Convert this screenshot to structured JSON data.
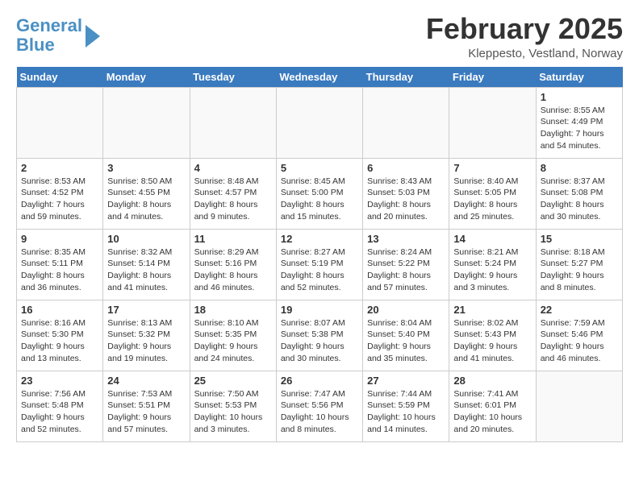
{
  "logo": {
    "line1": "General",
    "line2": "Blue"
  },
  "title": "February 2025",
  "subtitle": "Kleppesto, Vestland, Norway",
  "days_of_week": [
    "Sunday",
    "Monday",
    "Tuesday",
    "Wednesday",
    "Thursday",
    "Friday",
    "Saturday"
  ],
  "weeks": [
    [
      {
        "day": "",
        "info": ""
      },
      {
        "day": "",
        "info": ""
      },
      {
        "day": "",
        "info": ""
      },
      {
        "day": "",
        "info": ""
      },
      {
        "day": "",
        "info": ""
      },
      {
        "day": "",
        "info": ""
      },
      {
        "day": "1",
        "info": "Sunrise: 8:55 AM\nSunset: 4:49 PM\nDaylight: 7 hours\nand 54 minutes."
      }
    ],
    [
      {
        "day": "2",
        "info": "Sunrise: 8:53 AM\nSunset: 4:52 PM\nDaylight: 7 hours\nand 59 minutes."
      },
      {
        "day": "3",
        "info": "Sunrise: 8:50 AM\nSunset: 4:55 PM\nDaylight: 8 hours\nand 4 minutes."
      },
      {
        "day": "4",
        "info": "Sunrise: 8:48 AM\nSunset: 4:57 PM\nDaylight: 8 hours\nand 9 minutes."
      },
      {
        "day": "5",
        "info": "Sunrise: 8:45 AM\nSunset: 5:00 PM\nDaylight: 8 hours\nand 15 minutes."
      },
      {
        "day": "6",
        "info": "Sunrise: 8:43 AM\nSunset: 5:03 PM\nDaylight: 8 hours\nand 20 minutes."
      },
      {
        "day": "7",
        "info": "Sunrise: 8:40 AM\nSunset: 5:05 PM\nDaylight: 8 hours\nand 25 minutes."
      },
      {
        "day": "8",
        "info": "Sunrise: 8:37 AM\nSunset: 5:08 PM\nDaylight: 8 hours\nand 30 minutes."
      }
    ],
    [
      {
        "day": "9",
        "info": "Sunrise: 8:35 AM\nSunset: 5:11 PM\nDaylight: 8 hours\nand 36 minutes."
      },
      {
        "day": "10",
        "info": "Sunrise: 8:32 AM\nSunset: 5:14 PM\nDaylight: 8 hours\nand 41 minutes."
      },
      {
        "day": "11",
        "info": "Sunrise: 8:29 AM\nSunset: 5:16 PM\nDaylight: 8 hours\nand 46 minutes."
      },
      {
        "day": "12",
        "info": "Sunrise: 8:27 AM\nSunset: 5:19 PM\nDaylight: 8 hours\nand 52 minutes."
      },
      {
        "day": "13",
        "info": "Sunrise: 8:24 AM\nSunset: 5:22 PM\nDaylight: 8 hours\nand 57 minutes."
      },
      {
        "day": "14",
        "info": "Sunrise: 8:21 AM\nSunset: 5:24 PM\nDaylight: 9 hours\nand 3 minutes."
      },
      {
        "day": "15",
        "info": "Sunrise: 8:18 AM\nSunset: 5:27 PM\nDaylight: 9 hours\nand 8 minutes."
      }
    ],
    [
      {
        "day": "16",
        "info": "Sunrise: 8:16 AM\nSunset: 5:30 PM\nDaylight: 9 hours\nand 13 minutes."
      },
      {
        "day": "17",
        "info": "Sunrise: 8:13 AM\nSunset: 5:32 PM\nDaylight: 9 hours\nand 19 minutes."
      },
      {
        "day": "18",
        "info": "Sunrise: 8:10 AM\nSunset: 5:35 PM\nDaylight: 9 hours\nand 24 minutes."
      },
      {
        "day": "19",
        "info": "Sunrise: 8:07 AM\nSunset: 5:38 PM\nDaylight: 9 hours\nand 30 minutes."
      },
      {
        "day": "20",
        "info": "Sunrise: 8:04 AM\nSunset: 5:40 PM\nDaylight: 9 hours\nand 35 minutes."
      },
      {
        "day": "21",
        "info": "Sunrise: 8:02 AM\nSunset: 5:43 PM\nDaylight: 9 hours\nand 41 minutes."
      },
      {
        "day": "22",
        "info": "Sunrise: 7:59 AM\nSunset: 5:46 PM\nDaylight: 9 hours\nand 46 minutes."
      }
    ],
    [
      {
        "day": "23",
        "info": "Sunrise: 7:56 AM\nSunset: 5:48 PM\nDaylight: 9 hours\nand 52 minutes."
      },
      {
        "day": "24",
        "info": "Sunrise: 7:53 AM\nSunset: 5:51 PM\nDaylight: 9 hours\nand 57 minutes."
      },
      {
        "day": "25",
        "info": "Sunrise: 7:50 AM\nSunset: 5:53 PM\nDaylight: 10 hours\nand 3 minutes."
      },
      {
        "day": "26",
        "info": "Sunrise: 7:47 AM\nSunset: 5:56 PM\nDaylight: 10 hours\nand 8 minutes."
      },
      {
        "day": "27",
        "info": "Sunrise: 7:44 AM\nSunset: 5:59 PM\nDaylight: 10 hours\nand 14 minutes."
      },
      {
        "day": "28",
        "info": "Sunrise: 7:41 AM\nSunset: 6:01 PM\nDaylight: 10 hours\nand 20 minutes."
      },
      {
        "day": "",
        "info": ""
      }
    ]
  ]
}
